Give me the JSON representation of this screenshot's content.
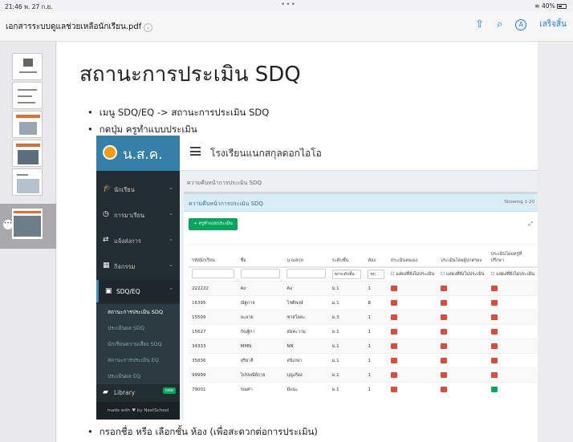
{
  "status": {
    "time": "21:46",
    "date": "พ. 27 ก.ย.",
    "battery": "40%"
  },
  "toolbar": {
    "doc_title": "เอกสารระบบดูแลช่วยเหลือนักเรียน.pdf",
    "done_label": "เสร็จสิ้น"
  },
  "slide": {
    "title": "สถานะการประเมิน SDQ",
    "bullet1": "เมนู SDQ/EQ -> สถานะการประเมิน SDQ",
    "bullet2": "กดปุ่ม ครูทำแบบประเมิน",
    "bullet3": "กรอกชื่อ หรือ เลือกชั้น ห้อง (เพื่อสะดวกต่อการประเมิน)"
  },
  "app": {
    "brand": "น.ส.ค.",
    "school": "โรงเรียนแนกสกุลดอกไอโอ",
    "nav": [
      {
        "icon": "graduation-cap-icon",
        "glyph": "🎓",
        "label": "นักเรียน"
      },
      {
        "icon": "clock-icon",
        "glyph": "◷",
        "label": "การมาเรียน"
      },
      {
        "icon": "shuffle-icon",
        "glyph": "⇄",
        "label": "แจ้งส่งการ"
      },
      {
        "icon": "calendar-icon",
        "glyph": "▦",
        "label": "กิจกรรม"
      },
      {
        "icon": "sdq-icon",
        "glyph": "▣",
        "label": "SDQ/EQ"
      }
    ],
    "subnav": [
      "สถานะการประเมิน SDQ",
      "ประเมินผล SDQ",
      "นักเรียนความเสี่ยง SDQ",
      "สถานะการประเมิน EQ",
      "ประเมินผล EQ"
    ],
    "library": {
      "label": "Library",
      "badge": "new"
    },
    "made_with": "made with ♥ by NextSchool",
    "breadcrumb": "ความคืบหน้าการประเมิน SDQ",
    "box_title": "ความคืบหน้าการประเมิน SDQ",
    "showing": "Showing 1-20",
    "teach_button": "+ ครูทำแบบประเมิน",
    "columns": [
      "รหัสนักเรียน",
      "ชื่อ",
      "นามสกุล",
      "ระดับชั้น",
      "ห้อง",
      "ประเมินตนเอง",
      "ประเมินโดยผู้ปกครอง",
      "ประเมินโดยครูที่ปรึกษา"
    ],
    "filters": {
      "level": "ทุกระดับชั้น",
      "room": "ทุก",
      "opt": "แสดงที่ยังไม่ประเมิน"
    },
    "rows": [
      {
        "id": "222222",
        "first": "Az",
        "last": "Ax",
        "level": "ม.1",
        "room": "1",
        "s": "red",
        "p": "red",
        "t": "red"
      },
      {
        "id": "16395",
        "first": "ณัฐกาล",
        "last": "โชติพงษ์",
        "level": "ม.1",
        "room": "8",
        "s": "red",
        "p": "red",
        "t": "red"
      },
      {
        "id": "15509",
        "first": "ละอาย",
        "last": "ซาสโลละ",
        "level": "ม.3",
        "room": "1",
        "s": "red",
        "p": "red",
        "t": "red"
      },
      {
        "id": "15627",
        "first": "กัณฐิกา",
        "last": "สมคะวาม",
        "level": "ม.1",
        "room": "1",
        "s": "red",
        "p": "red",
        "t": "red"
      },
      {
        "id": "34333",
        "first": "MMN",
        "last": "NN",
        "level": "ม.1",
        "room": "1",
        "s": "red",
        "p": "red",
        "t": "red"
      },
      {
        "id": "35836",
        "first": "สุริยาลี",
        "last": "สนิเกษา",
        "level": "ม.1",
        "room": "1",
        "s": "red",
        "p": "red",
        "t": "red"
      },
      {
        "id": "99999",
        "first": "ไปรษณีย์กาย",
        "last": "บุญเกียง",
        "level": "ม.1",
        "room": "1",
        "s": "red",
        "p": "red",
        "t": "red"
      },
      {
        "id": "79001",
        "first": "รเมศา",
        "last": "มีแนะ",
        "level": "ม.1",
        "room": "1",
        "s": "red",
        "p": "red",
        "t": "green"
      }
    ]
  },
  "colors": {
    "accent": "#1b7cf2",
    "nav_bg": "#222d32",
    "brand_bg": "#367fa9",
    "green": "#00a65a",
    "red": "#dd4b39"
  }
}
